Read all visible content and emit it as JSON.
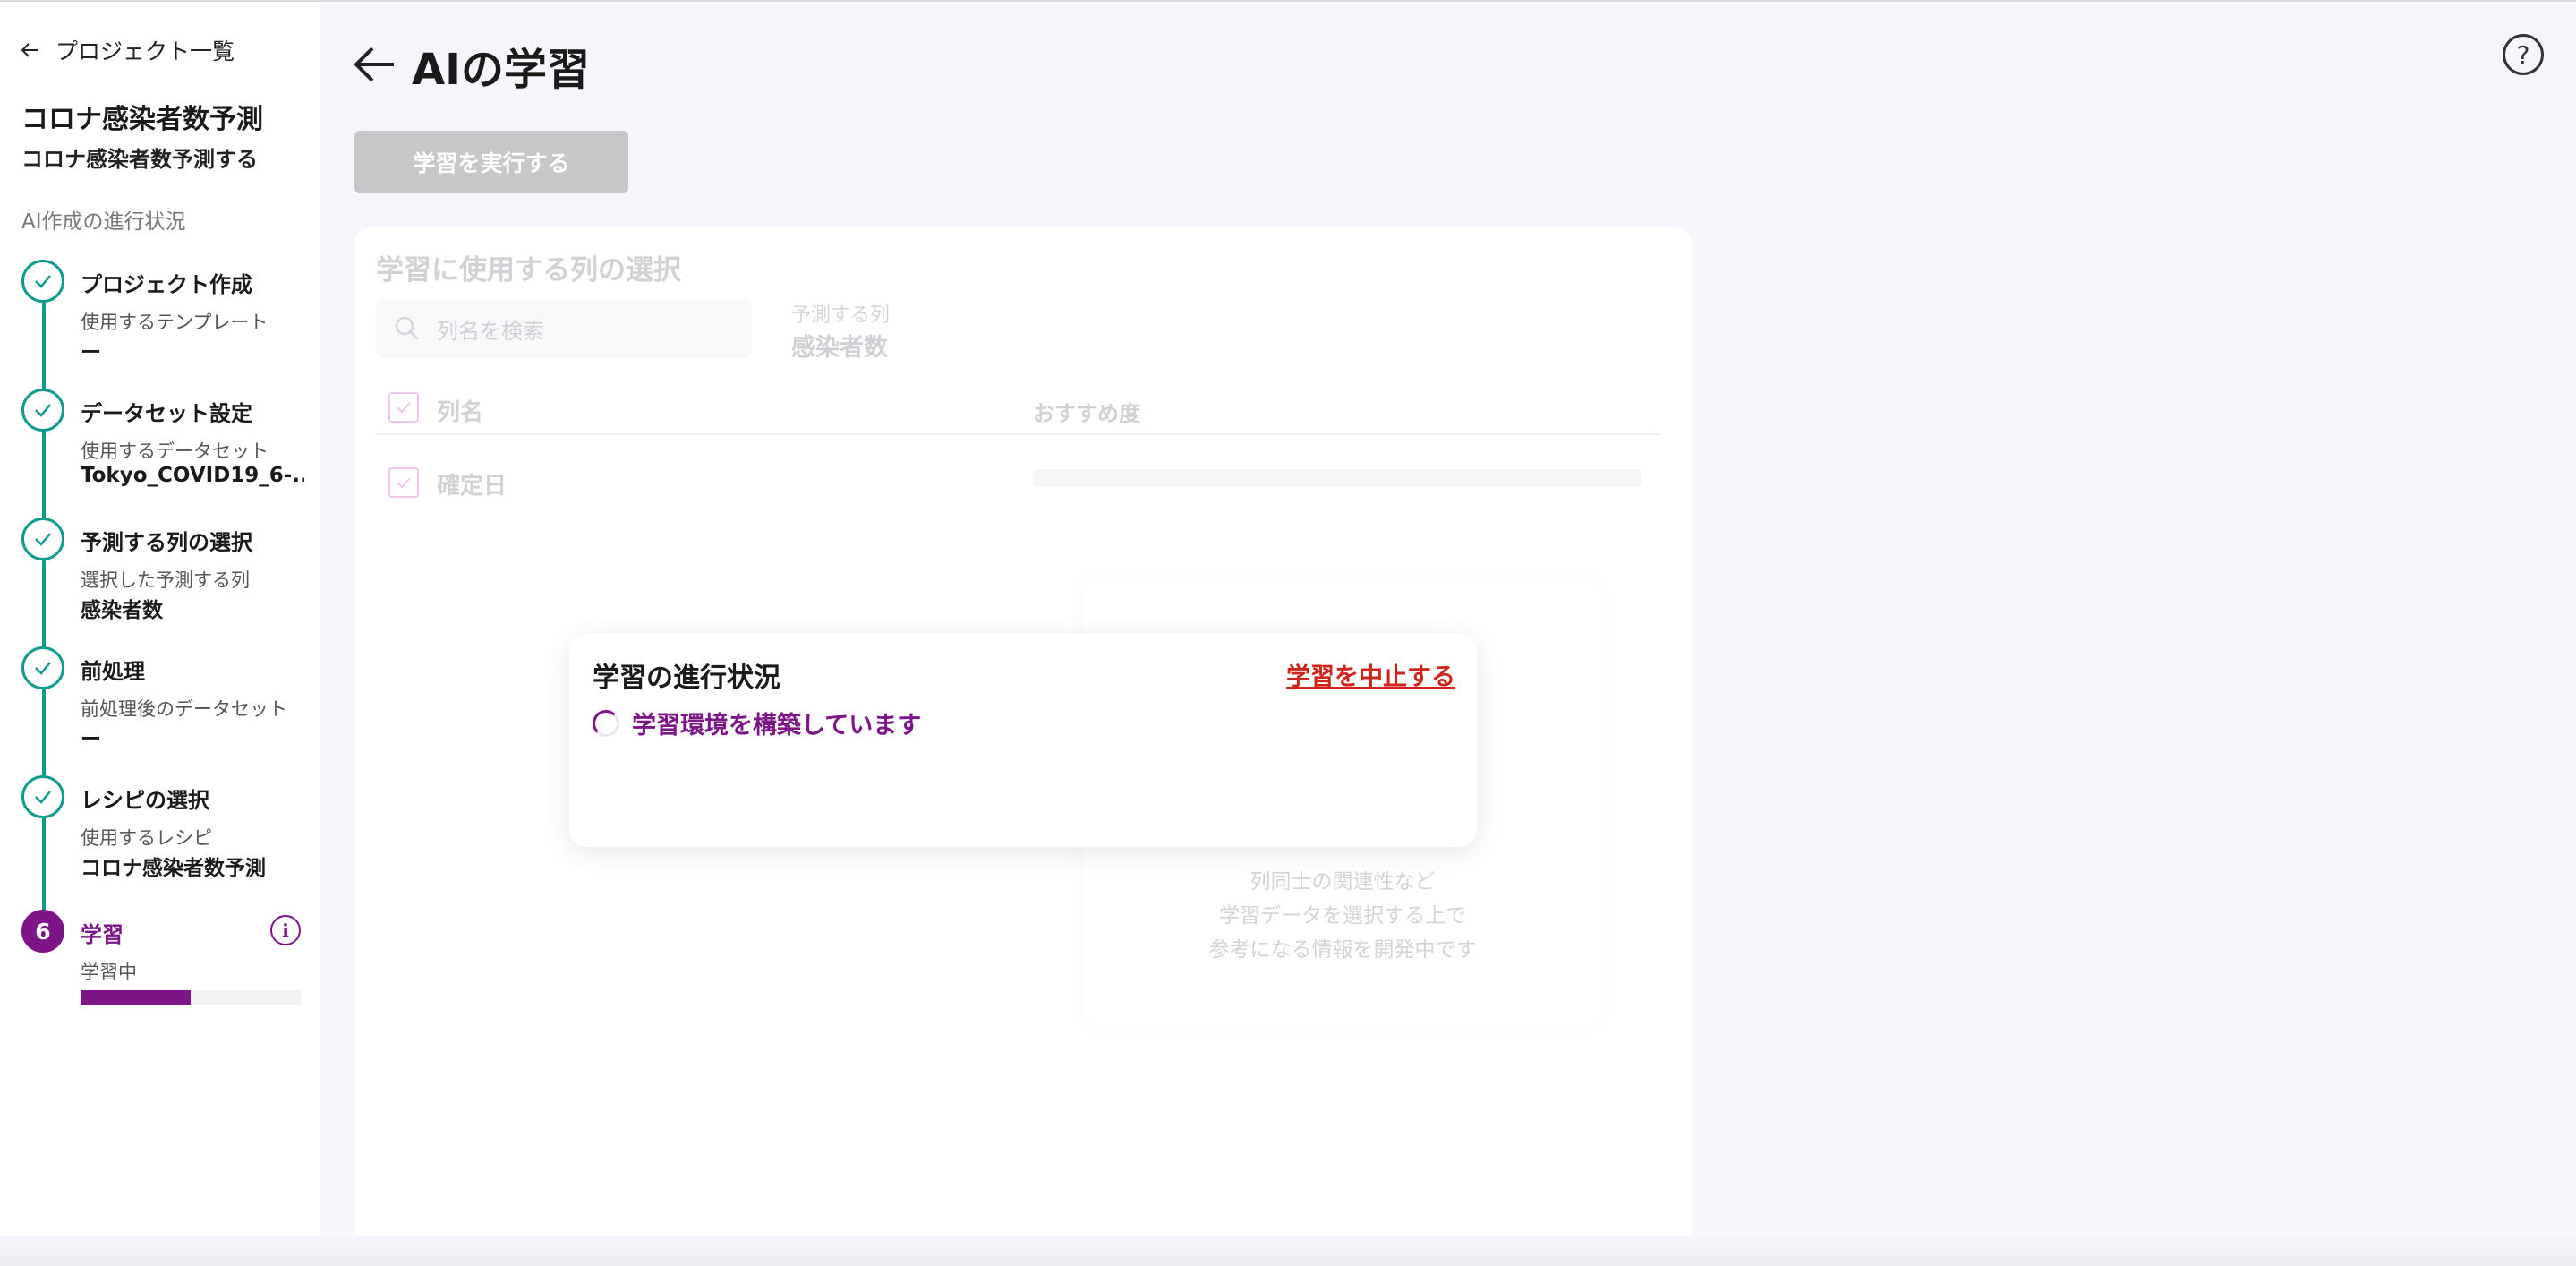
{
  "sidebar": {
    "back_label": "プロジェクト一覧",
    "project_title": "コロナ感染者数予測",
    "project_subtitle": "コロナ感染者数予測する",
    "progress_label": "AI作成の進行状況",
    "steps": [
      {
        "title": "プロジェクト作成",
        "sublabel": "使用するテンプレート",
        "value": "ー",
        "status": "done"
      },
      {
        "title": "データセット設定",
        "sublabel": "使用するデータセット",
        "value": "Tokyo_COVID19_6-...",
        "status": "done"
      },
      {
        "title": "予測する列の選択",
        "sublabel": "選択した予測する列",
        "value": "感染者数",
        "status": "done"
      },
      {
        "title": "前処理",
        "sublabel": "前処理後のデータセット",
        "value": "ー",
        "status": "done"
      },
      {
        "title": "レシピの選択",
        "sublabel": "使用するレシピ",
        "value": "コロナ感染者数予測",
        "status": "done"
      },
      {
        "number": "6",
        "title": "学習",
        "sublabel": "学習中",
        "status": "active",
        "progress": 0.5
      }
    ]
  },
  "header": {
    "title": "AIの学習",
    "help_icon": "question-mark-icon"
  },
  "run_button_label": "学習を実行する",
  "column_selection": {
    "title": "学習に使用する列の選択",
    "search_placeholder": "列名を検索",
    "predict_label": "予測する列",
    "predict_value": "感染者数",
    "header_name": "列名",
    "header_recommend": "おすすめ度",
    "rows": [
      {
        "name": "確定日"
      }
    ],
    "info_text_lines": [
      "列同士の関連性など",
      "学習データを選択する上で",
      "参考になる情報を開発中です"
    ]
  },
  "progress_dialog": {
    "title": "学習の進行状況",
    "cancel_label": "学習を中止する",
    "status_text": "学習環境を構築しています"
  },
  "colors": {
    "accent": "#7d1487",
    "done": "#0f9b8e",
    "danger": "#d0241b"
  }
}
